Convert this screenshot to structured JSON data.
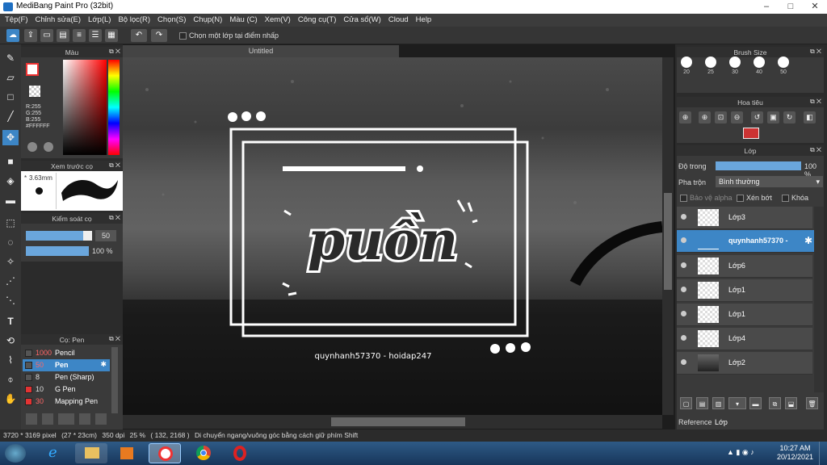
{
  "window": {
    "title": "MediBang Paint Pro (32bit)"
  },
  "menu": [
    "Tệp(F)",
    "Chỉnh sửa(E)",
    "Lớp(L)",
    "Bộ lọc(R)",
    "Chọn(S)",
    "Chụp(N)",
    "Màu (C)",
    "Xem(V)",
    "Công cụ(T)",
    "Cửa sổ(W)",
    "Cloud",
    "Help"
  ],
  "toolbar": {
    "select_layer_label": "Chọn một lớp tại điểm nhấp"
  },
  "color_panel": {
    "title": "Màu",
    "r": "R:255",
    "g": "G:255",
    "b": "B:255",
    "hex": "#FFFFFF"
  },
  "preview_panel": {
    "title": "Xem trước cọ",
    "size": "3.63mm"
  },
  "control_panel": {
    "title": "Kiểm soát cọ",
    "size_value": "50",
    "opacity_value": "100 %",
    "size_fraction": 0.87,
    "opacity_fraction": 1.0
  },
  "brush_panel": {
    "title": "Cọ: Pen",
    "items": [
      {
        "size": "1000",
        "name": "Pencil",
        "swatch": "#555555"
      },
      {
        "size": "50",
        "name": "Pen",
        "swatch": "#555555"
      },
      {
        "size": "8",
        "name": "Pen (Sharp)",
        "swatch": "#555555"
      },
      {
        "size": "10",
        "name": "G Pen",
        "swatch": "#e23333"
      },
      {
        "size": "30",
        "name": "Mapping Pen",
        "swatch": "#e23333"
      }
    ]
  },
  "canvas": {
    "tab": "Untitled",
    "artwork": {
      "main": "puồn",
      "caption": "quynhanh57370 - hoidap247"
    }
  },
  "brush_size_panel": {
    "title": "Brush Size",
    "sizes": [
      "20",
      "25",
      "30",
      "40",
      "50"
    ]
  },
  "navigator_panel": {
    "title": "Hoa tiêu"
  },
  "layer_panel": {
    "title": "Lớp",
    "opacity_label": "Độ trong",
    "opacity_value": "100 %",
    "blend_label": "Pha trộn",
    "blend_value": "Bình thường",
    "protect_alpha": "Bảo vệ alpha",
    "clip": "Xén bớt",
    "lock": "Khóa",
    "layers": [
      "Lớp3",
      "quynhanh57370 -",
      "Lớp6",
      "Lớp1",
      "Lớp1",
      "Lớp4",
      "Lớp2"
    ],
    "tabs": [
      "Reference",
      "Lớp"
    ]
  },
  "status": {
    "size": "3720 * 3169 pixel",
    "physical": "(27 * 23cm)",
    "dpi": "350 dpi",
    "zoom": "25 %",
    "coords": "( 132, 2168 )",
    "hint": "Di chuyển ngang/vuông góc bằng cách giữ phím Shift"
  },
  "taskbar": {
    "time": "10:27 AM",
    "date": "20/12/2021"
  },
  "colors": {
    "accent": "#4a90d9",
    "selected_layer": "#3d86c6"
  }
}
